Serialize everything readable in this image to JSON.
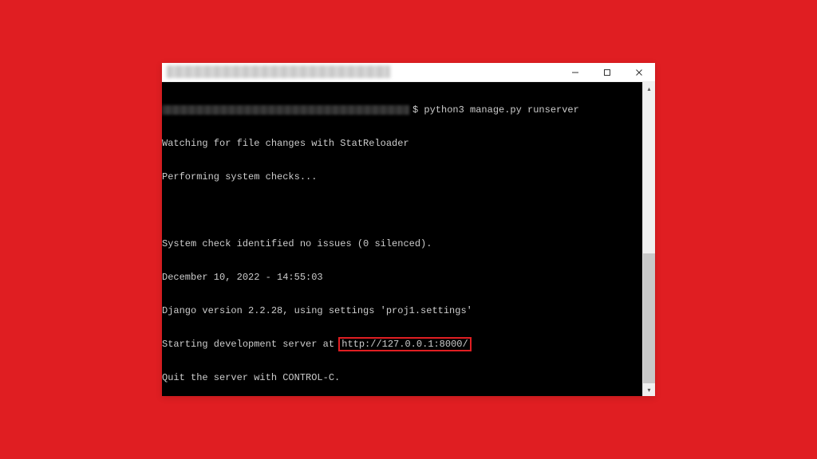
{
  "window": {
    "controls": {
      "minimize": "minimize",
      "maximize": "maximize",
      "close": "close"
    }
  },
  "terminal": {
    "prompt_suffix": "$ ",
    "command": "python3 manage.py runserver",
    "lines": {
      "l1": "Watching for file changes with StatReloader",
      "l2": "Performing system checks...",
      "l3": "",
      "l4": "System check identified no issues (0 silenced).",
      "l5": "December 10, 2022 - 14:55:03",
      "l6": "Django version 2.2.28, using settings 'proj1.settings'",
      "l7a": "Starting development server at ",
      "l7_url": "http://127.0.0.1:8000/",
      "l8": "Quit the server with CONTROL-C."
    }
  },
  "highlight_color": "#e01e22"
}
